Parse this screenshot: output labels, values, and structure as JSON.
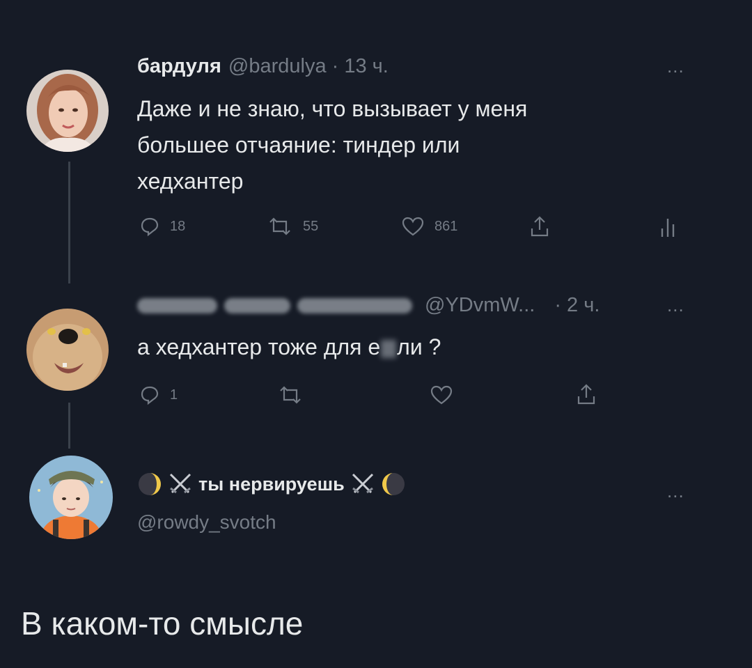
{
  "tweet1": {
    "display_name": "бардуля",
    "handle_time": "@bardulya · 13 ч.",
    "more": "...",
    "text_lines": [
      "Даже и не знаю, что вызывает у меня",
      "большее отчаяние: тиндер или",
      "хедхантер"
    ],
    "replies": "18",
    "retweets": "55",
    "likes": "861"
  },
  "tweet2": {
    "handle": "@YDvmW...",
    "time": "· 2 ч.",
    "more": "...",
    "text_before": "а хедхантер тоже для е",
    "text_after": "ли ?",
    "replies": "1"
  },
  "tweet3": {
    "display_name": "ты нервируешь",
    "handle": "@rowdy_svotch",
    "more": "...",
    "main_text": "В каком-то смысле"
  },
  "colors": {
    "background": "#161b26",
    "text": "#e7e9ea",
    "muted": "#757c86"
  }
}
